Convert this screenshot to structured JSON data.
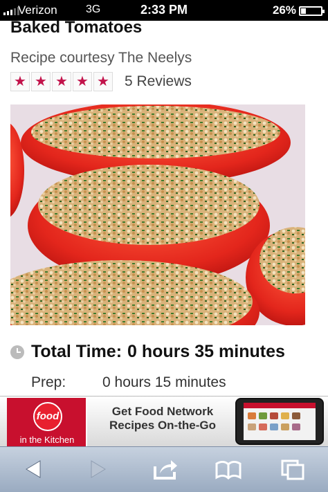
{
  "status_bar": {
    "carrier": "Verizon",
    "network": "3G",
    "time": "2:33 PM",
    "battery_percent": "26%",
    "battery_level": 0.26
  },
  "recipe": {
    "title": "Baked Tomatoes",
    "credit": "Recipe courtesy The Neelys",
    "rating_stars": 5,
    "star_glyph": "★",
    "reviews": "5 Reviews",
    "total_time_label": "Total Time:",
    "total_time_value": "0 hours 35 minutes",
    "prep_label": "Prep:",
    "prep_value": "0 hours 15 minutes"
  },
  "ad": {
    "brand": "food",
    "brand_subtitle": "in the Kitchen",
    "text_line1": "Get Food Network",
    "text_line2": "Recipes On-the-Go",
    "brand_color": "#c8102e"
  },
  "toolbar": {
    "icons": [
      "back-arrow-icon",
      "forward-arrow-icon",
      "share-icon",
      "bookmarks-icon",
      "tabs-icon"
    ]
  }
}
